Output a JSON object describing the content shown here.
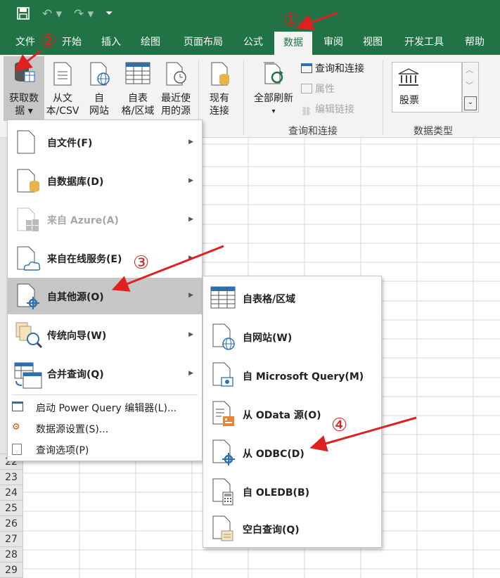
{
  "qat": {
    "save_icon": "save-icon",
    "undo_icon": "undo-icon",
    "redo_icon": "redo-icon",
    "customize_icon": "customize-icon"
  },
  "tabs": [
    "文件",
    "开始",
    "插入",
    "绘图",
    "页面布局",
    "公式",
    "数据",
    "审阅",
    "视图",
    "开发工具",
    "帮助"
  ],
  "active_tab": "数据",
  "ribbon": {
    "get_data": [
      "获取数",
      "据 ▾"
    ],
    "from_text": [
      "从文",
      "本/CSV"
    ],
    "from_web": [
      "自",
      "网站"
    ],
    "from_table": [
      "自表",
      "格/区域"
    ],
    "recent_sources": [
      "最近使",
      "用的源"
    ],
    "existing_conn": [
      "现有",
      "连接"
    ],
    "refresh_all": [
      "全部刷新",
      "▾"
    ],
    "queries_connections": "查询和连接",
    "properties": "属性",
    "edit_links": "编辑链接",
    "group_queries": "查询和连接",
    "stocks": "股票",
    "group_datatypes": "数据类型"
  },
  "rows": [
    "22",
    "23",
    "24",
    "25",
    "26",
    "27",
    "28",
    "29"
  ],
  "menu1": {
    "items": [
      "自文件(F)",
      "自数据库(D)",
      "来自 Azure(A)",
      "来自在线服务(E)",
      "自其他源(O)",
      "传统向导(W)",
      "合并查询(Q)"
    ],
    "small_items": [
      "启动 Power Query 编辑器(L)...",
      "数据源设置(S)...",
      "查询选项(P)"
    ]
  },
  "menu2": {
    "items": [
      "自表格/区域",
      "自网站(W)",
      "自 Microsoft Query(M)",
      "从 OData 源(O)",
      "从 ODBC(D)",
      "自 OLEDB(B)",
      "空白查询(Q)"
    ]
  },
  "annotations": [
    "①",
    "②",
    "③",
    "④"
  ],
  "colors": {
    "excel_green": "#217346",
    "annotation_red": "#e02020",
    "highlight": "#c6c6c6"
  }
}
